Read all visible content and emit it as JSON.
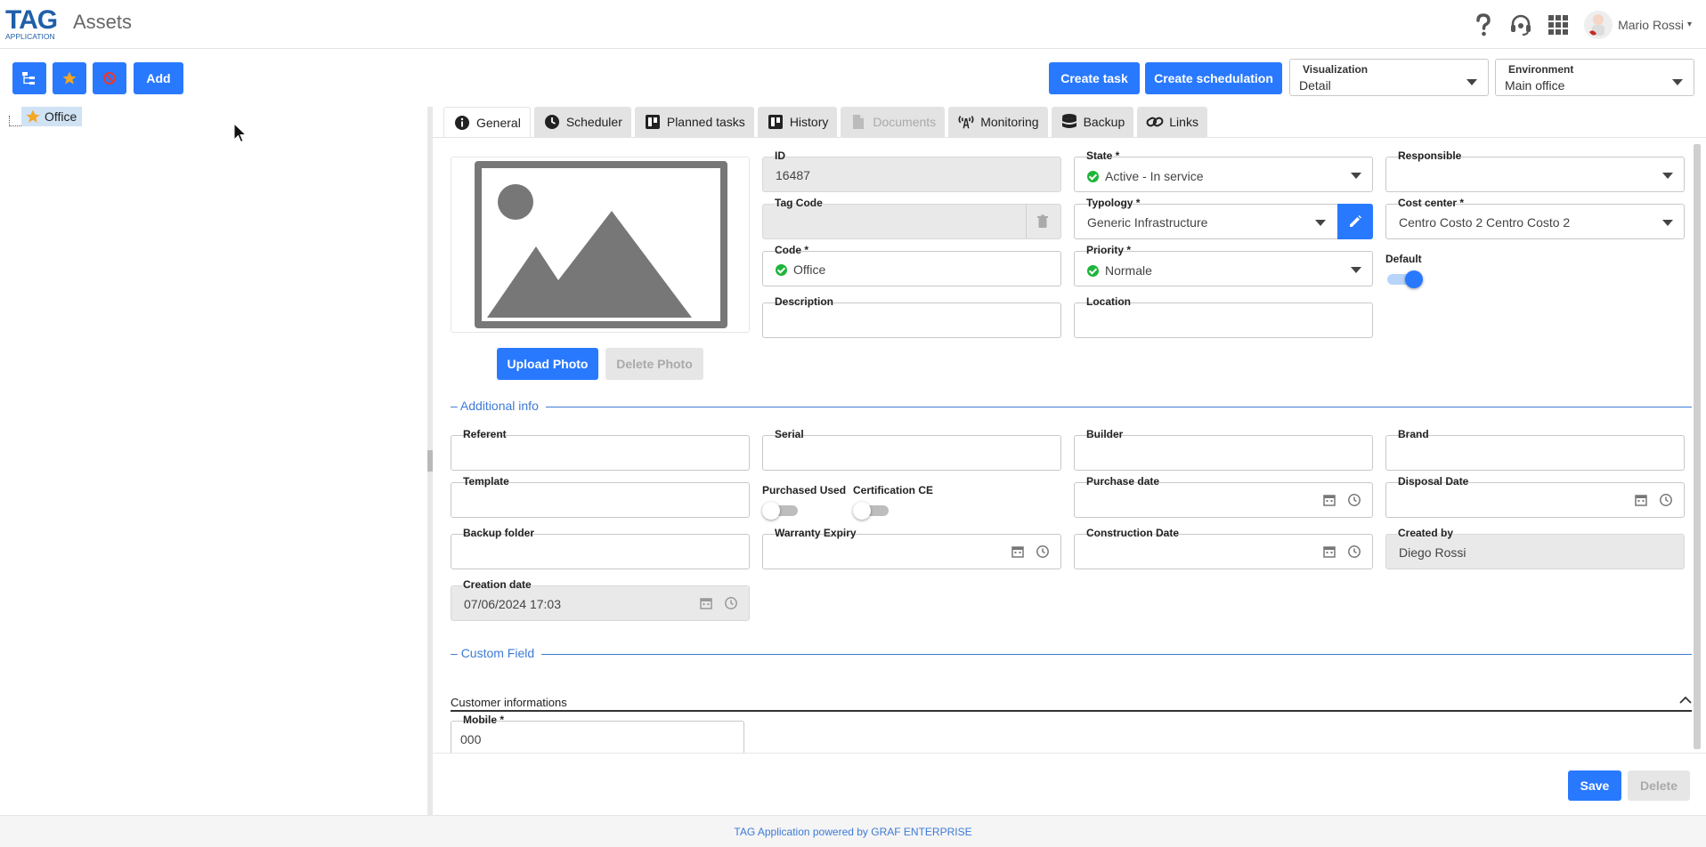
{
  "header": {
    "logo_text": "TAG",
    "logo_subtext": "APPLICATION",
    "title": "Assets",
    "user_name": "Mario Rossi",
    "icons": [
      "help-icon",
      "support-headset-icon",
      "apps-grid-icon"
    ]
  },
  "toolbar": {
    "buttons": [
      "tree-icon",
      "star-icon",
      "block-icon"
    ],
    "add_label": "Add",
    "create_task_label": "Create task",
    "create_schedulation_label": "Create schedulation",
    "visualization": {
      "label": "Visualization",
      "value": "Detail"
    },
    "environment": {
      "label": "Environment",
      "value": "Main office"
    }
  },
  "tree": {
    "root": {
      "label": "Office",
      "icon": "star-icon"
    }
  },
  "tabs": [
    {
      "label": "General",
      "icon": "info-icon",
      "state": "active"
    },
    {
      "label": "Scheduler",
      "icon": "clock-icon",
      "state": "normal"
    },
    {
      "label": "Planned tasks",
      "icon": "board-icon",
      "state": "normal"
    },
    {
      "label": "History",
      "icon": "board-icon",
      "state": "normal"
    },
    {
      "label": "Documents",
      "icon": "document-icon",
      "state": "disabled"
    },
    {
      "label": "Monitoring",
      "icon": "antenna-icon",
      "state": "normal"
    },
    {
      "label": "Backup",
      "icon": "database-icon",
      "state": "normal"
    },
    {
      "label": "Links",
      "icon": "link-icon",
      "state": "normal"
    }
  ],
  "photo": {
    "upload_label": "Upload Photo",
    "delete_label": "Delete Photo"
  },
  "general": {
    "id": {
      "label": "ID",
      "value": "16487"
    },
    "tag_code": {
      "label": "Tag Code",
      "value": ""
    },
    "code": {
      "label": "Code *",
      "value": "Office"
    },
    "description": {
      "label": "Description",
      "value": ""
    },
    "state": {
      "label": "State *",
      "value": "Active - In service"
    },
    "typology": {
      "label": "Typology *",
      "value": "Generic Infrastructure"
    },
    "priority": {
      "label": "Priority *",
      "value": "Normale"
    },
    "location": {
      "label": "Location",
      "value": ""
    },
    "responsible": {
      "label": "Responsible",
      "value": ""
    },
    "cost_center": {
      "label": "Cost center *",
      "value": "Centro Costo 2 Centro Costo 2"
    },
    "default": {
      "label": "Default",
      "on": true
    }
  },
  "additional": {
    "section_title": "Additional info",
    "referent": {
      "label": "Referent",
      "value": ""
    },
    "serial": {
      "label": "Serial",
      "value": ""
    },
    "builder": {
      "label": "Builder",
      "value": ""
    },
    "brand": {
      "label": "Brand",
      "value": ""
    },
    "template": {
      "label": "Template",
      "value": ""
    },
    "purchased_used": {
      "label": "Purchased Used",
      "on": false
    },
    "certification_ce": {
      "label": "Certification CE",
      "on": false
    },
    "purchase_date": {
      "label": "Purchase date",
      "value": ""
    },
    "disposal_date": {
      "label": "Disposal Date",
      "value": ""
    },
    "backup_folder": {
      "label": "Backup folder",
      "value": ""
    },
    "warranty_expiry": {
      "label": "Warranty Expiry",
      "value": ""
    },
    "construction_date": {
      "label": "Construction Date",
      "value": ""
    },
    "created_by": {
      "label": "Created by",
      "value": "Diego Rossi"
    },
    "creation_date": {
      "label": "Creation date",
      "value": "07/06/2024 17:03"
    }
  },
  "custom": {
    "section_title": "Custom Field",
    "group_title": "Customer informations",
    "mobile": {
      "label": "Mobile *",
      "value": "000"
    }
  },
  "actions": {
    "save_label": "Save",
    "delete_label": "Delete"
  },
  "footer": {
    "text": "TAG Application powered by GRAF ENTERPRISE"
  },
  "colors": {
    "primary": "#2979ff",
    "accent_line": "#3d7ad6",
    "success": "#1eb53a"
  }
}
